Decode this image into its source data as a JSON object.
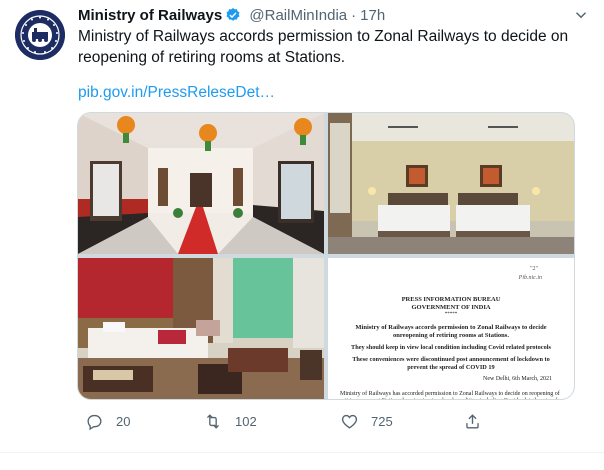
{
  "tweet": {
    "author_name": "Ministry of Railways",
    "handle": "@RailMinIndia",
    "separator": "·",
    "time": "17h",
    "text": "Ministry of Railways accords permission to Zonal Railways to decide on reopening of retiring rooms at Stations.",
    "link": "pib.gov.in/PressReleseDet…",
    "avatar_text": "INDIAN RAILWAYS"
  },
  "document": {
    "number": "\"2\"",
    "top_date": "Pib.nic.in",
    "org_line1": "PRESS INFORMATION BUREAU",
    "org_line2": "GOVERNMENT OF INDIA",
    "stars": "*****",
    "title": "Ministry of Railways accords permission to Zonal Railways to decide onreopening of retiring rooms at Stations.",
    "sub1": "They should keep in view local condition including Covid related protocols",
    "sub2": "These conveniences were discontinued post announcement of lockdown to prevent the spread of COVID 19",
    "place_date": "New Delhi, 6th March, 2021",
    "body": "Ministry of Railways has accorded permission to Zonal Railways to decide on reopening of retiring rooms at Stations keeping in view local condition including Covid related protocols"
  },
  "actions": {
    "reply_count": "20",
    "retweet_count": "102",
    "like_count": "725"
  },
  "icons": {
    "verified": "verified-badge-icon",
    "more": "chevron-down-icon",
    "reply": "reply-icon",
    "retweet": "retweet-icon",
    "like": "heart-icon",
    "share": "share-icon"
  },
  "colors": {
    "accent": "#1d9bf0",
    "secondary_text": "#536471",
    "avatar_bg": "#1d2d63"
  }
}
